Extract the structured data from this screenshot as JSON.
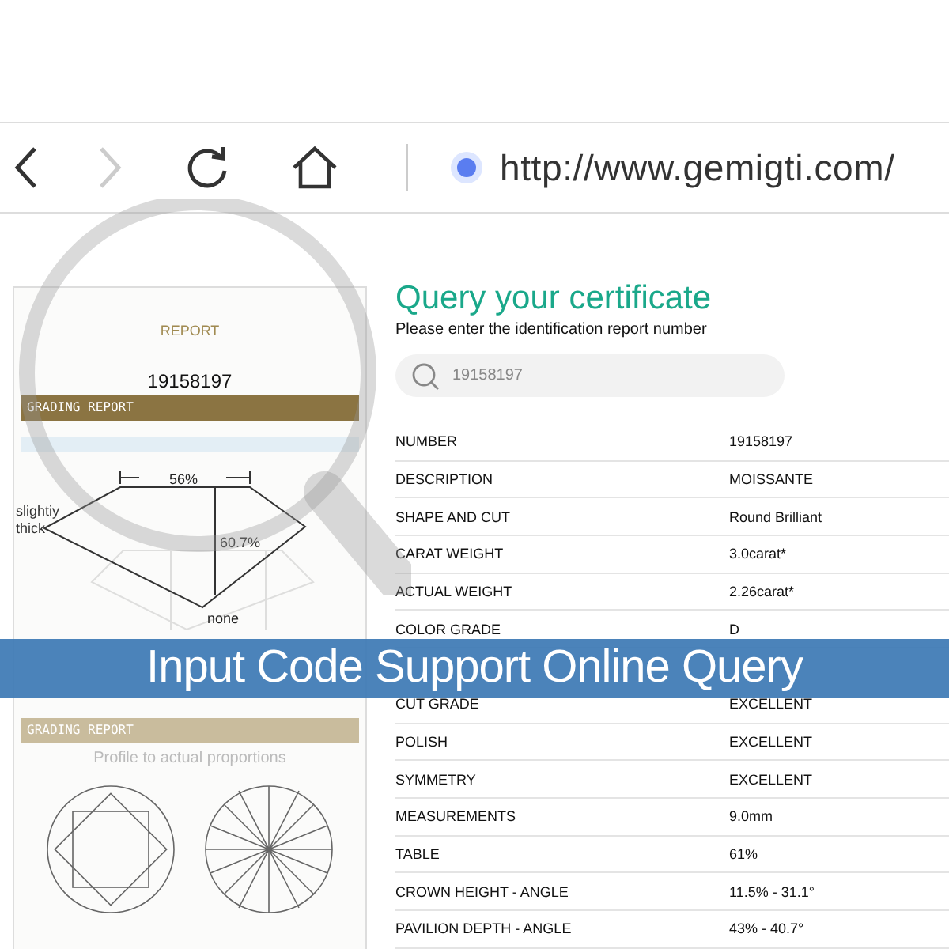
{
  "browser": {
    "url": "http://www.gemigti.com/",
    "back_disabled": false,
    "forward_disabled": true
  },
  "certificate": {
    "heading": "REPORT",
    "number": "19158197",
    "band_1": "GRADING REPORT",
    "table_pct": "56%",
    "girdle": "slightiy thick",
    "depth_pct": "60.7%",
    "culet": "none",
    "band_2": "GRADING REPORT",
    "caption": "Profile to actual proportions"
  },
  "query": {
    "title": "Query your certificate",
    "subtitle": "Please enter the identification report number",
    "search_value": "19158197"
  },
  "table": {
    "rows": [
      {
        "label": "NUMBER",
        "value": "19158197"
      },
      {
        "label": "DESCRIPTION",
        "value": "MOISSANTE"
      },
      {
        "label": "SHAPE AND CUT",
        "value": "Round Brilliant"
      },
      {
        "label": "CARAT WEIGHT",
        "value": "3.0carat*"
      },
      {
        "label": "ACTUAL WEIGHT",
        "value": "2.26carat*"
      },
      {
        "label": "COLOR GRADE",
        "value": "D"
      },
      {
        "label": "CUT GRADE",
        "value": "EXCELLENT"
      },
      {
        "label": "POLISH",
        "value": "EXCELLENT"
      },
      {
        "label": "SYMMETRY",
        "value": "EXCELLENT"
      },
      {
        "label": "MEASUREMENTS",
        "value": "9.0mm"
      },
      {
        "label": "TABLE",
        "value": "61%"
      },
      {
        "label": "CROWN HEIGHT - ANGLE",
        "value": "11.5% - 31.1°"
      },
      {
        "label": "PAVILION DEPTH - ANGLE",
        "value": "43% - 40.7°"
      }
    ]
  },
  "banner": {
    "text": "Input Code Support Online Query"
  }
}
